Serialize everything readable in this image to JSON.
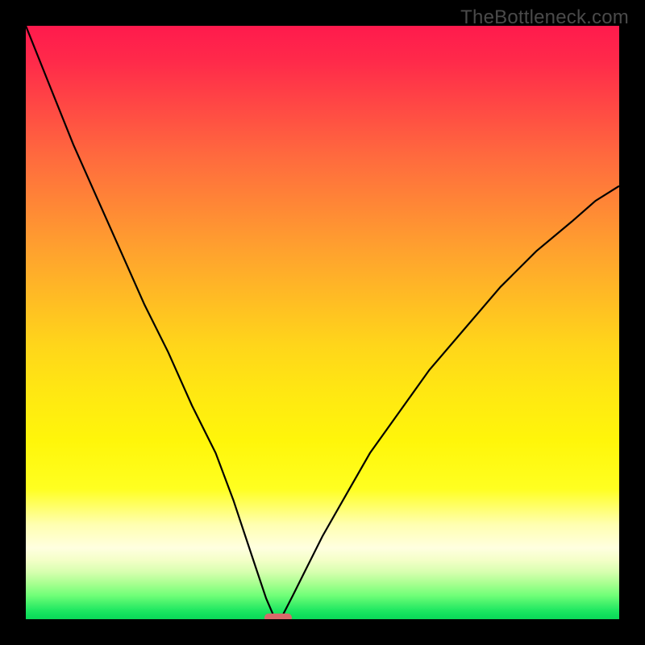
{
  "watermark": "TheBottleneck.com",
  "colors": {
    "frame": "#000000",
    "curve": "#000000",
    "marker": "#d86a6a",
    "watermark": "#4a4a4a"
  },
  "chart_data": {
    "type": "line",
    "title": "",
    "xlabel": "",
    "ylabel": "",
    "xlim": [
      0,
      100
    ],
    "ylim": [
      0,
      100
    ],
    "grid": false,
    "legend": false,
    "description": "V-shaped bottleneck curve with sharp notch near x≈42 reaching y≈0; left arm rises to y=100 at x=0, right arm rises to y≈73 at x=100. Background is a vertical red→orange→yellow→green gradient.",
    "series": [
      {
        "name": "bottleneck-curve-left",
        "x": [
          0,
          4,
          8,
          12,
          16,
          20,
          24,
          28,
          32,
          35,
          37,
          39,
          40.5,
          41.8
        ],
        "values": [
          100,
          90,
          80,
          71,
          62,
          53,
          45,
          36,
          28,
          20,
          14,
          8,
          3.5,
          0.5
        ]
      },
      {
        "name": "bottleneck-curve-right",
        "x": [
          43.2,
          45,
          47,
          50,
          54,
          58,
          63,
          68,
          74,
          80,
          86,
          92,
          96,
          100
        ],
        "values": [
          0.5,
          4,
          8,
          14,
          21,
          28,
          35,
          42,
          49,
          56,
          62,
          67,
          70.5,
          73
        ]
      }
    ],
    "marker": {
      "x_center": 42.5,
      "width": 4.6,
      "y": 0.3
    }
  }
}
